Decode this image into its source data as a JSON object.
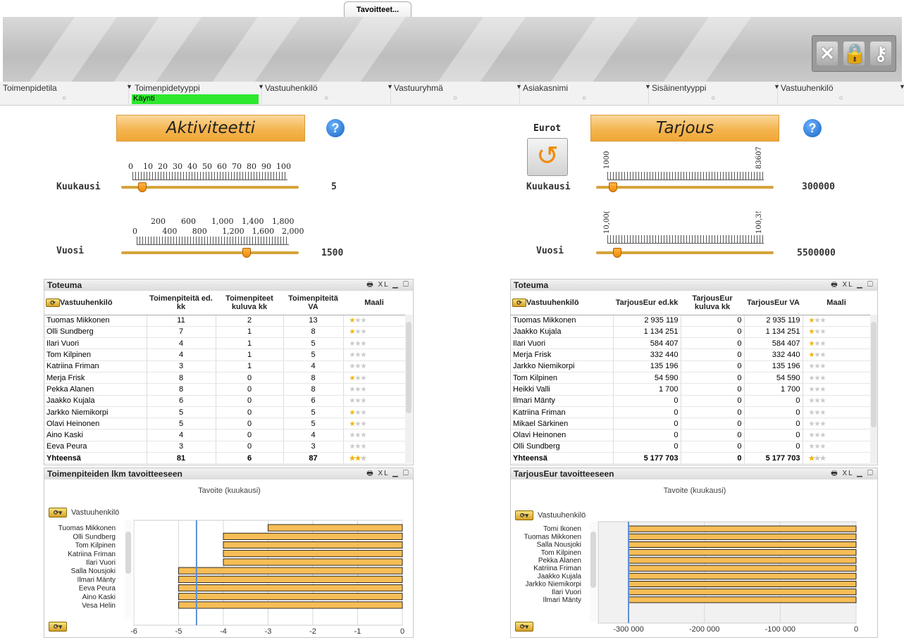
{
  "tab": {
    "label": "Tavoitteet..."
  },
  "filters": [
    {
      "label": "Toimenpidetila",
      "value": "○"
    },
    {
      "label": "Toimenpidetyyppi",
      "value": "Käynti"
    },
    {
      "label": "Vastuuhenkilö",
      "value": "○"
    },
    {
      "label": "Vastuuryhmä",
      "value": "○"
    },
    {
      "label": "Asiakasnimi",
      "value": "○"
    },
    {
      "label": "Sisäinentyyppi",
      "value": "○"
    },
    {
      "label": "Vastuuhenkilö",
      "value": "○"
    }
  ],
  "left": {
    "title": "Aktiviteetti",
    "month": {
      "label": "Kuukausi",
      "value": "5",
      "ticks": [
        "0",
        "10",
        "20",
        "30",
        "40",
        "50",
        "60",
        "70",
        "80",
        "90",
        "100"
      ],
      "level": 5
    },
    "year": {
      "label": "Vuosi",
      "value": "1500",
      "ticks_top": [
        "200",
        "600",
        "1,000",
        "1,400",
        "1,800"
      ],
      "ticks_bottom": [
        "0",
        "400",
        "800",
        "1,200",
        "1,600",
        "2,000"
      ],
      "level": 1500
    },
    "table": {
      "title": "Toteuma",
      "headers": [
        "Vastuuhenkilö",
        "Toimenpiteitä ed. kk",
        "Toimenpiteet kuluva kk",
        "Toimenpiteitä VA",
        "Maali"
      ],
      "rows": [
        [
          "Tuomas Mikkonen",
          "11",
          "2",
          "13",
          1
        ],
        [
          "Olli Sundberg",
          "7",
          "1",
          "8",
          1
        ],
        [
          "Ilari Vuori",
          "4",
          "1",
          "5",
          0
        ],
        [
          "Tom Kilpinen",
          "4",
          "1",
          "5",
          0
        ],
        [
          "Katriina Friman",
          "3",
          "1",
          "4",
          0
        ],
        [
          "Merja Frisk",
          "8",
          "0",
          "8",
          1
        ],
        [
          "Pekka Alanen",
          "8",
          "0",
          "8",
          0
        ],
        [
          "Jaakko Kujala",
          "6",
          "0",
          "6",
          0
        ],
        [
          "Jarkko Niemikorpi",
          "5",
          "0",
          "5",
          1
        ],
        [
          "Olavi Heinonen",
          "5",
          "0",
          "5",
          1
        ],
        [
          "Aino Kaski",
          "4",
          "0",
          "4",
          0
        ],
        [
          "Eeva Peura",
          "3",
          "0",
          "3",
          0
        ]
      ],
      "total": [
        "Yhteensä",
        "81",
        "6",
        "87",
        2
      ]
    },
    "chart_title": "Toimenpiteiden lkm tavoitteeseen"
  },
  "right": {
    "currency_label": "Eurot",
    "title": "Tarjous",
    "month": {
      "label": "Kuukausi",
      "value": "300000",
      "tick_low": "1000",
      "tick_high": "83607",
      "level": 300000
    },
    "year": {
      "label": "Vuosi",
      "value": "5500000",
      "tick_low": "10,00(",
      "tick_high": "100,3!",
      "level": 5500000
    },
    "table": {
      "title": "Toteuma",
      "headers": [
        "Vastuuhenkilö",
        "TarjousEur ed.kk",
        "TarjousEur kuluva kk",
        "TarjousEur VA",
        "Maali"
      ],
      "rows": [
        [
          "Tuomas Mikkonen",
          "2 935 119",
          "0",
          "2 935 119",
          1
        ],
        [
          "Jaakko Kujala",
          "1 134 251",
          "0",
          "1 134 251",
          1
        ],
        [
          "Ilari Vuori",
          "584 407",
          "0",
          "584 407",
          1
        ],
        [
          "Merja Frisk",
          "332 440",
          "0",
          "332 440",
          1
        ],
        [
          "Jarkko Niemikorpi",
          "135 196",
          "0",
          "135 196",
          0
        ],
        [
          "Tom Kilpinen",
          "54 590",
          "0",
          "54 590",
          0
        ],
        [
          "Heikki Valli",
          "1 700",
          "0",
          "1 700",
          0
        ],
        [
          "Ilmari Mänty",
          "0",
          "0",
          "0",
          0
        ],
        [
          "Katriina Friman",
          "0",
          "0",
          "0",
          0
        ],
        [
          "Mikael Särkinen",
          "0",
          "0",
          "0",
          0
        ],
        [
          "Olavi Heinonen",
          "0",
          "0",
          "0",
          0
        ],
        [
          "Olli Sundberg",
          "0",
          "0",
          "0",
          0
        ]
      ],
      "total": [
        "Yhteensä",
        "5 177 703",
        "0",
        "5 177 703",
        1
      ]
    },
    "chart_title": "TarjousEur tavoitteeseen"
  },
  "chart_data": [
    {
      "type": "bar",
      "title": "Tavoite (kuukausi)",
      "dimension_label": "Vastuuhenkilö",
      "categories": [
        "Tuomas Mikkonen",
        "Olli Sundberg",
        "Tom Kilpinen",
        "Katriina Friman",
        "Ilari Vuori",
        "Salla Nousjoki",
        "Ilmari Mänty",
        "Eeva Peura",
        "Aino Kaski",
        "Vesa Helin"
      ],
      "values": [
        -3,
        -4,
        -4,
        -4,
        -4,
        -5,
        -5,
        -5,
        -5,
        -5
      ],
      "xlim": [
        -6,
        0
      ],
      "xticks": [
        "-6",
        "-5",
        "-4",
        "-3",
        "-2",
        "-1",
        "0"
      ],
      "reference_line": -4.6
    },
    {
      "type": "bar",
      "title": "Tavoite (kuukausi)",
      "dimension_label": "Vastuuhenkilö",
      "categories": [
        "Tomi Ikonen",
        "Tuomas Mikkonen",
        "Salla Nousjoki",
        "Tom Kilpinen",
        "Pekka Alanen",
        "Katriina Friman",
        "Jaakko Kujala",
        "Jarkko Niemikorpi",
        "Ilari Vuori",
        "Ilmari Mänty"
      ],
      "values": [
        -300000,
        -300000,
        -300000,
        -300000,
        -300000,
        -300000,
        -300000,
        -300000,
        -300000,
        -300000
      ],
      "xlim": [
        -340000,
        0
      ],
      "xticks": [
        "-300 000",
        "-200 000",
        "-100 000",
        "0"
      ],
      "xtick_values": [
        -300000,
        -200000,
        -100000,
        0
      ],
      "reference_line": -300000
    }
  ],
  "colors": {
    "accent": "#f0a635",
    "selected": "#2ee82e",
    "bar": "#f7bd56"
  }
}
